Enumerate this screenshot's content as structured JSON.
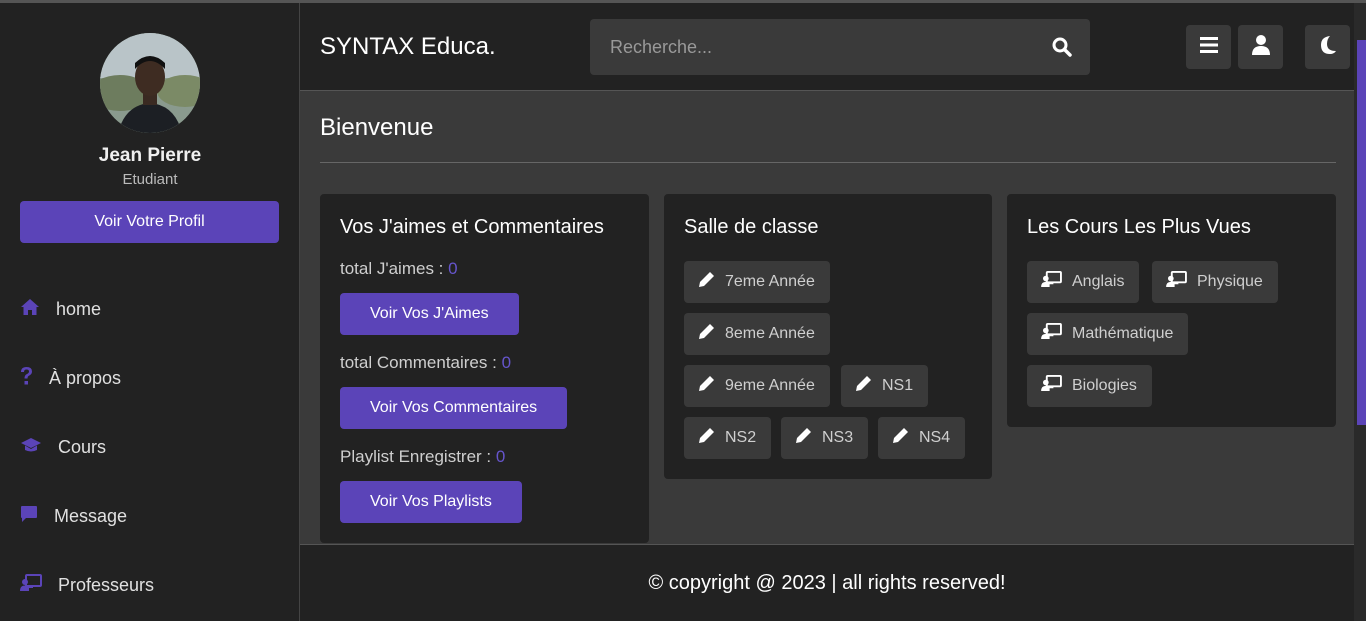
{
  "sidebar": {
    "user_name": "Jean Pierre",
    "user_role": "Etudiant",
    "profile_button": "Voir Votre Profil",
    "nav": [
      {
        "label": "home",
        "icon": "home-icon"
      },
      {
        "label": "À propos",
        "icon": "question-icon"
      },
      {
        "label": "Cours",
        "icon": "graduation-cap-icon"
      },
      {
        "label": "Message",
        "icon": "message-icon"
      },
      {
        "label": "Professeurs",
        "icon": "teacher-icon"
      }
    ]
  },
  "header": {
    "logo": "SYNTAX Educa.",
    "search_placeholder": "Recherche...",
    "buttons": [
      "menu-icon",
      "user-icon",
      "moon-icon"
    ]
  },
  "main": {
    "title": "Bienvenue",
    "likes_card": {
      "title": "Vos J'aimes et Commentaires",
      "likes_label": "total J'aimes : ",
      "likes_value": "0",
      "likes_button": "Voir Vos J'Aimes",
      "comments_label": "total Commentaires : ",
      "comments_value": "0",
      "comments_button": "Voir Vos Commentaires",
      "playlist_label": "Playlist Enregistrer : ",
      "playlist_value": "0",
      "playlist_button": "Voir Vos Playlists"
    },
    "classroom_card": {
      "title": "Salle de classe",
      "tags": [
        "7eme Année",
        "8eme Année",
        "9eme Année",
        "NS1",
        "NS2",
        "NS3",
        "NS4"
      ]
    },
    "courses_card": {
      "title": "Les Cours Les Plus Vues",
      "tags": [
        "Anglais",
        "Physique",
        "Mathématique",
        "Biologies"
      ]
    }
  },
  "footer": {
    "text": "© copyright @ 2023 | all rights reserved!"
  },
  "colors": {
    "accent": "#5b44b8",
    "sidebar_bg": "#222222",
    "content_bg": "#3a3a3a"
  }
}
